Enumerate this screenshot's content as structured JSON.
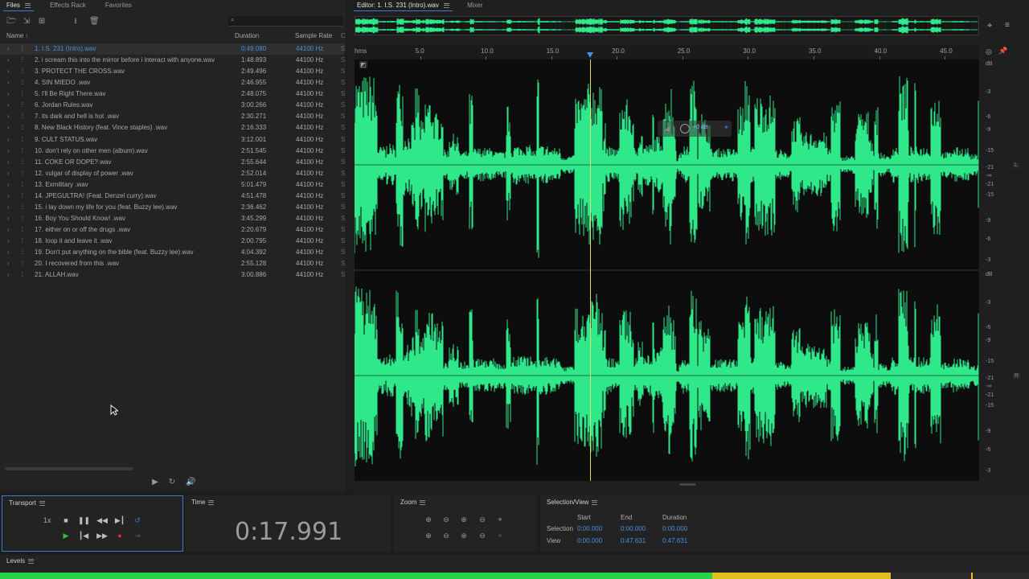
{
  "files_panel": {
    "tabs": [
      "Files",
      "Effects Rack",
      "Favorites"
    ],
    "search_placeholder": "",
    "columns": {
      "name": "Name",
      "duration": "Duration",
      "sample_rate": "Sample Rate",
      "extra": "C"
    },
    "files": [
      {
        "name": "1. I.S. 231 (Intro).wav",
        "duration": "0:49.080",
        "rate": "44100 Hz"
      },
      {
        "name": "2. i scream this into the mirror before i interact with anyone.wav",
        "duration": "1:48.893",
        "rate": "44100 Hz"
      },
      {
        "name": "3. PROTECT THE CROSS.wav",
        "duration": "2:49.496",
        "rate": "44100 Hz"
      },
      {
        "name": "4. SIN MIEDO .wav",
        "duration": "2:46.955",
        "rate": "44100 Hz"
      },
      {
        "name": "5. I'll Be Right There.wav",
        "duration": "2:48.075",
        "rate": "44100 Hz"
      },
      {
        "name": "6. Jordan Rules.wav",
        "duration": "3:00.266",
        "rate": "44100 Hz"
      },
      {
        "name": "7. its dark and hell is hot .wav",
        "duration": "2:30.271",
        "rate": "44100 Hz"
      },
      {
        "name": "8. New Black History (feat. Vince staples) .wav",
        "duration": "2:16.333",
        "rate": "44100 Hz"
      },
      {
        "name": "9. CULT STATUS.wav",
        "duration": "3:12.001",
        "rate": "44100 Hz"
      },
      {
        "name": "10. don't rely on other men (album).wav",
        "duration": "2:51.545",
        "rate": "44100 Hz"
      },
      {
        "name": "11. COKE OR DOPE?.wav",
        "duration": "2:55.644",
        "rate": "44100 Hz"
      },
      {
        "name": "12. vulgar of display of power .wav",
        "duration": "2:52.014",
        "rate": "44100 Hz"
      },
      {
        "name": "13. Exmilitary .wav",
        "duration": "5:01.479",
        "rate": "44100 Hz"
      },
      {
        "name": "14. JPEGULTRA! (Feat. Denzel curry).wav",
        "duration": "4:51.478",
        "rate": "44100 Hz"
      },
      {
        "name": "15. i lay down my life for you (feat. Buzzy lee).wav",
        "duration": "2:36.462",
        "rate": "44100 Hz"
      },
      {
        "name": "16. Boy You Should Know! .wav",
        "duration": "3:45.299",
        "rate": "44100 Hz"
      },
      {
        "name": "17. either on or off the drugs .wav",
        "duration": "2:20.679",
        "rate": "44100 Hz"
      },
      {
        "name": "18. loop it and leave it .wav",
        "duration": "2:00.795",
        "rate": "44100 Hz"
      },
      {
        "name": "19. Don't put anything on the bible (feat. Buzzy lee).wav",
        "duration": "4:04.392",
        "rate": "44100 Hz"
      },
      {
        "name": "20. I recovered from this .wav",
        "duration": "2:55.128",
        "rate": "44100 Hz"
      },
      {
        "name": "21. ALLAH.wav",
        "duration": "3:00.886",
        "rate": "44100 Hz"
      }
    ]
  },
  "editor": {
    "tab_label": "Editor: 1. I.S. 231 (Intro).wav",
    "mixer_label": "Mixer",
    "ruler_unit": "hms",
    "ruler_ticks": [
      "5.0",
      "10.0",
      "15.0",
      "20.0",
      "25.0",
      "30.0",
      "35.0",
      "40.0",
      "45.0"
    ],
    "db_unit": "dB",
    "db_labels": [
      "-3",
      "-6",
      "-9",
      "-15",
      "-21",
      "-∞",
      "-21",
      "-15",
      "-9",
      "-6",
      "-3"
    ],
    "channel_left": "L",
    "channel_right": "R",
    "hud_gain": "+0 dB",
    "playhead_seconds": 17.991,
    "visible_range_seconds": [
      0,
      47.631
    ],
    "waveform_color": "#2ee88a"
  },
  "transport": {
    "title": "Transport",
    "speed": "1x",
    "accent": "#3a7bd5",
    "record_color": "#e03030",
    "play_color": "#36c236"
  },
  "time": {
    "title": "Time",
    "value": "0:17.991"
  },
  "zoom": {
    "title": "Zoom"
  },
  "selection_view": {
    "title": "Selection/View",
    "headers": {
      "start": "Start",
      "end": "End",
      "duration": "Duration"
    },
    "rows": [
      {
        "label": "Selection",
        "start": "0:00.000",
        "end": "0:00.000",
        "duration": "0:00.000"
      },
      {
        "label": "View",
        "start": "0:00.000",
        "end": "0:47.631",
        "duration": "0:47.631"
      }
    ]
  },
  "levels": {
    "title": "Levels"
  }
}
